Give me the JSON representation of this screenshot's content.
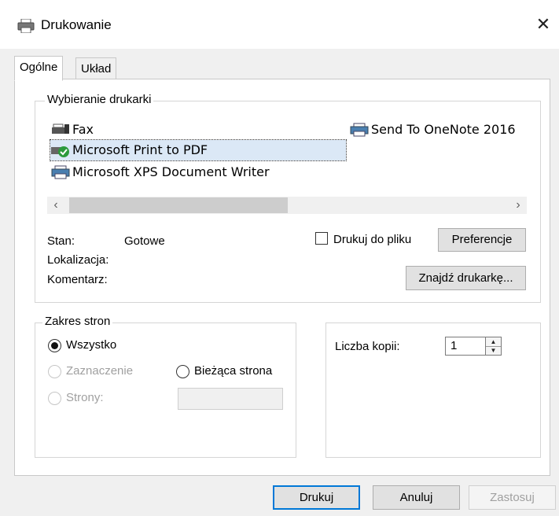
{
  "window": {
    "title": "Drukowanie",
    "title_icon": "printer-icon",
    "close_symbol": "✕"
  },
  "tabs": [
    {
      "label": "Ogólne",
      "active": true
    },
    {
      "label": "Układ",
      "active": false
    }
  ],
  "printer_section": {
    "label": "Wybieranie drukarki",
    "printers": [
      {
        "name": "Fax",
        "icon": "fax-printer-icon"
      },
      {
        "name": "Microsoft Print to PDF",
        "icon": "default-printer-check-icon",
        "selected": true
      },
      {
        "name": "Microsoft XPS Document Writer",
        "icon": "printer-icon"
      },
      {
        "name": "Send To OneNote 2016",
        "icon": "printer-icon"
      }
    ],
    "scroll_left": "‹",
    "scroll_right": "›",
    "status_label": "Stan:",
    "status_value": "Gotowe",
    "location_label": "Lokalizacja:",
    "comment_label": "Komentarz:",
    "print_to_file_label": "Drukuj do pliku",
    "print_to_file_checked": false,
    "preferences_button": "Preferencje",
    "find_printer_button": "Znajdź drukarkę..."
  },
  "page_range": {
    "label": "Zakres stron",
    "all": "Wszystko",
    "selection": "Zaznaczenie",
    "current_page": "Bieżąca strona",
    "pages": "Strony:",
    "pages_value": "",
    "selected_option": "all"
  },
  "copies": {
    "label": "Liczba kopii:",
    "value": "1"
  },
  "footer": {
    "print_button": "Drukuj",
    "cancel_button": "Anuluj",
    "apply_button": "Zastosuj"
  },
  "colors": {
    "accent": "#0078d7",
    "selection": "#dbe8f6",
    "check_green": "#2c9a3c"
  }
}
